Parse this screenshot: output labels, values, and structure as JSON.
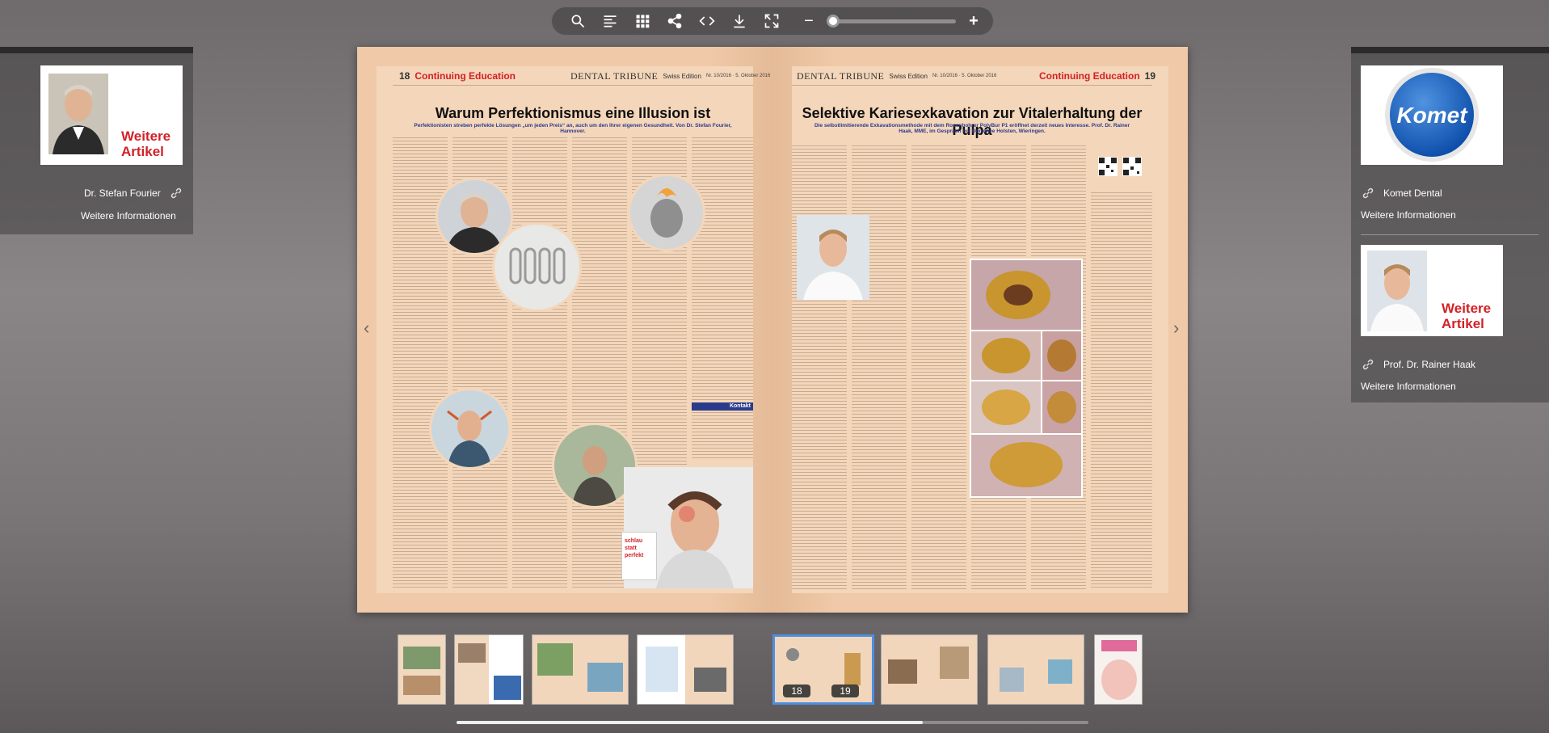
{
  "toolbar": {
    "buttons": [
      "search-icon",
      "toc-icon",
      "grid-icon",
      "share-icon",
      "embed-icon",
      "download-icon",
      "fullscreen-icon"
    ],
    "zoom_out": "−",
    "zoom_in": "+",
    "zoom_level": 0.0
  },
  "left_panel": {
    "card_label": "Weitere Artikel",
    "author": "Dr. Stefan Fourier",
    "more_info": "Weitere Informationen"
  },
  "right_panel": {
    "logo_text": "Komet",
    "company": "Komet Dental",
    "more_info_1": "Weitere Informationen",
    "card_label": "Weitere Artikel",
    "author": "Prof. Dr. Rainer Haak",
    "more_info_2": "Weitere Informationen"
  },
  "left_page": {
    "page_number": "18",
    "section": "Continuing Education",
    "brand": "DENTAL TRIBUNE",
    "edition": "Swiss Edition",
    "issue": "Nr. 10/2016 · 5. Oktober 2016",
    "headline": "Warum Perfektionismus eine Illusion ist",
    "subline": "Perfektionisten streben perfekte Lösungen „um jeden Preis“ an, auch um den Ihrer eigenen Gesundheit. Von Dr. Stefan Fourier, Hannover.",
    "contact_label": "Kontakt",
    "book_title": "schlau statt perfekt"
  },
  "right_page": {
    "page_number": "19",
    "section": "Continuing Education",
    "brand": "DENTAL TRIBUNE",
    "edition": "Swiss Edition",
    "issue": "Nr. 10/2016 · 5. Oktober 2016",
    "headline": "Selektive Kariesexkavation zur Vitalerhaltung der Pulpa",
    "subline": "Die selbstlimitierende Exkavationsmethode mit dem Rosenbohrer PolyBur P1 eröffnet derzeit neues Interesse. Prof. Dr. Rainer Haak, MME, im Gespräch mit Dorothee Holsten, Wieringen."
  },
  "thumbnails": {
    "active_left": "18",
    "active_right": "19"
  },
  "colors": {
    "accent_red": "#d32027",
    "page_bg": "#f4d6ba",
    "active_thumb": "#4e8fe3"
  }
}
